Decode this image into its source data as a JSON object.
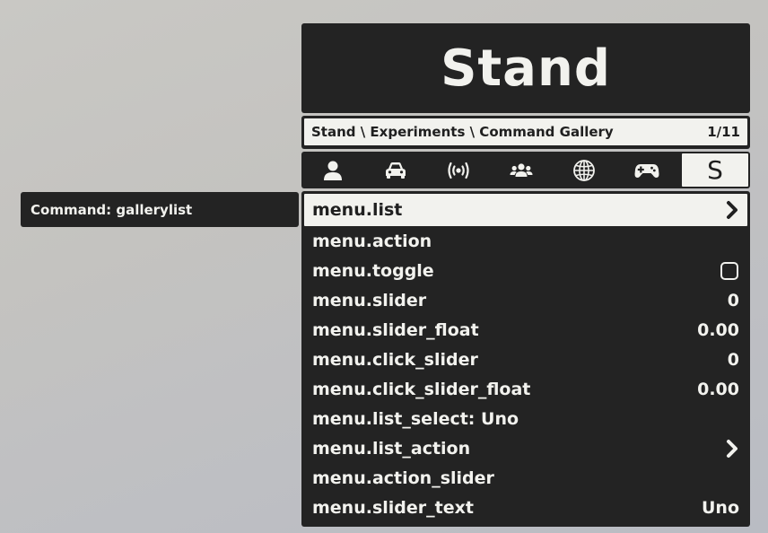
{
  "header": {
    "title": "Stand"
  },
  "breadcrumb": {
    "path": "Stand \\ Experiments \\ Command Gallery",
    "position": "1/11"
  },
  "tabs": [
    {
      "icon": "person-icon"
    },
    {
      "icon": "car-icon"
    },
    {
      "icon": "broadcast-icon"
    },
    {
      "icon": "players-icon"
    },
    {
      "icon": "globe-icon"
    },
    {
      "icon": "gamepad-icon"
    },
    {
      "icon": "stand-logo-icon",
      "label": "S",
      "active": true
    }
  ],
  "tooltip": {
    "text": "Command: gallerylist"
  },
  "items": [
    {
      "label": "menu.list",
      "value": "",
      "indicator": "chevron-right-icon"
    },
    {
      "label": "menu.action",
      "value": ""
    },
    {
      "label": "menu.toggle",
      "value": "",
      "indicator": "checkbox-icon"
    },
    {
      "label": "menu.slider",
      "value": "0"
    },
    {
      "label": "menu.slider_float",
      "value": "0.00"
    },
    {
      "label": "menu.click_slider",
      "value": "0"
    },
    {
      "label": "menu.click_slider_float",
      "value": "0.00"
    },
    {
      "label": "menu.list_select: Uno",
      "value": ""
    },
    {
      "label": "menu.list_action",
      "value": "",
      "indicator": "chevron-right-icon"
    },
    {
      "label": "menu.action_slider",
      "value": ""
    },
    {
      "label": "menu.slider_text",
      "value": "Uno"
    }
  ],
  "colors": {
    "panel": "#232323",
    "text_light": "#f2f2ee",
    "text_dark": "#202020"
  }
}
